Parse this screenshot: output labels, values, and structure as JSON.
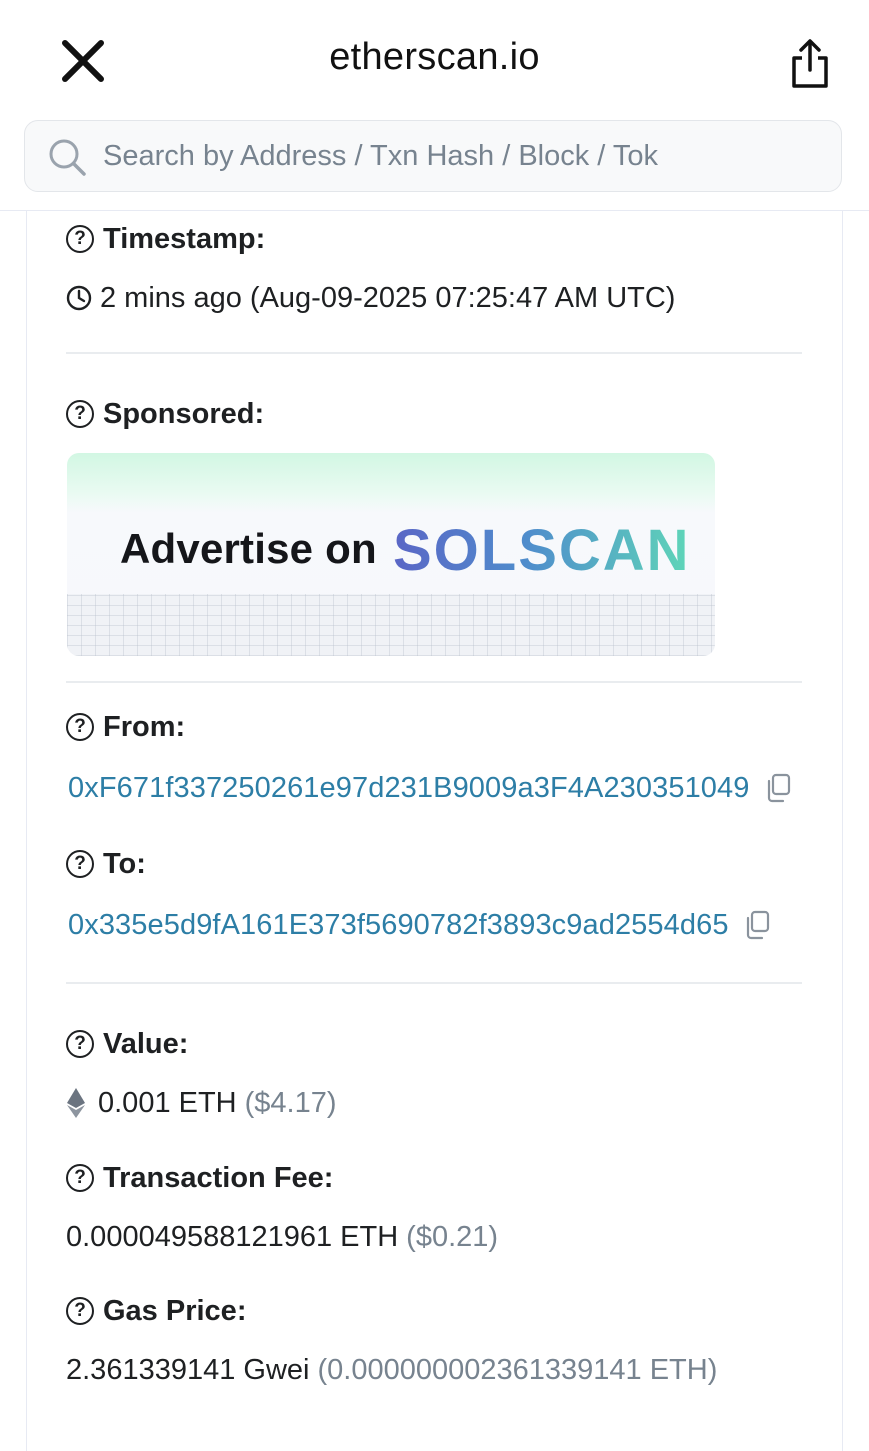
{
  "header": {
    "title": "etherscan.io",
    "close_icon": "close-icon",
    "share_icon": "share-icon"
  },
  "search": {
    "placeholder": "Search by Address / Txn Hash / Block / Tok",
    "icon": "search-icon"
  },
  "details": {
    "timestamp": {
      "label": "Timestamp:",
      "value": "2 mins ago (Aug-09-2025 07:25:47 AM UTC)"
    },
    "sponsored": {
      "label": "Sponsored:",
      "banner_text": "Advertise on",
      "banner_brand": "SOLSCAN"
    },
    "from": {
      "label": "From:",
      "address": "0xF671f337250261e97d231B9009a3F4A230351049"
    },
    "to": {
      "label": "To:",
      "address": "0x335e5d9fA161E373f5690782f3893c9ad2554d65"
    },
    "value": {
      "label": "Value:",
      "amount": "0.001 ETH",
      "usd": "($4.17)"
    },
    "fee": {
      "label": "Transaction Fee:",
      "amount": "0.000049588121961 ETH",
      "usd": "($0.21)"
    },
    "gas_price": {
      "label": "Gas Price:",
      "amount": "2.361339141 Gwei",
      "eth": "(0.000000002361339141 ETH)"
    }
  },
  "colors": {
    "link": "#2d7ea6",
    "text": "#1e2022",
    "muted": "#77838f",
    "banner_green": "#d2f7e3"
  }
}
